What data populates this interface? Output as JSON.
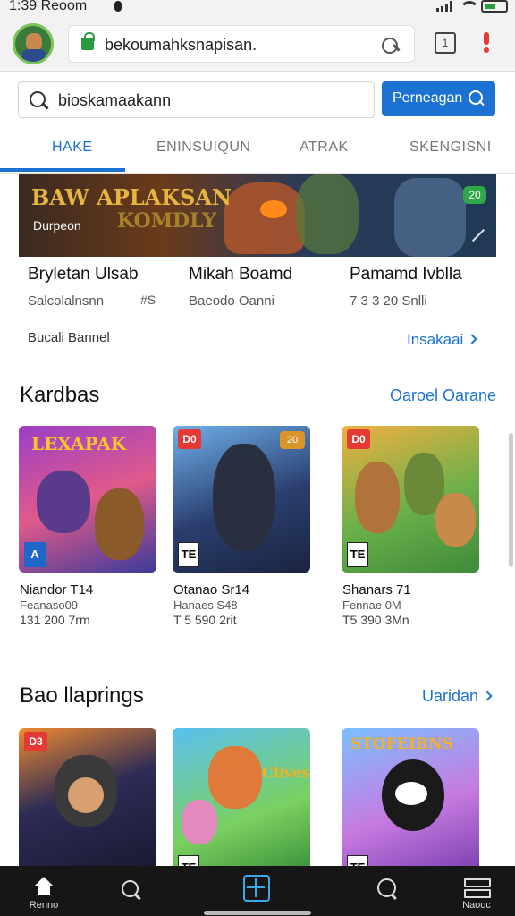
{
  "status_bar": {
    "time": "1:39 Reoom"
  },
  "browser": {
    "url": "bekoumahksnapisan.",
    "tabs_label": "1"
  },
  "search": {
    "value": "bioskamaakann",
    "button_label": "Perneagan"
  },
  "tabs": [
    {
      "label": "HAKE",
      "active": true
    },
    {
      "label": "ENINSUIQUN",
      "active": false
    },
    {
      "label": "ATRAK",
      "active": false
    },
    {
      "label": "SKENGISNI",
      "active": false
    }
  ],
  "banner": {
    "title": "BAW APLAKSAN",
    "title_line2": "KOMDLY",
    "subtitle": "Durpeon",
    "badge": "20"
  },
  "info": [
    {
      "title": "Bryletan Ulsab",
      "sub": "Salcolalnsnn"
    },
    {
      "title": "Mikah Boamd",
      "sub": "Baeodo Oanni"
    },
    {
      "title": "Pamamd Ivblla",
      "sub": "7 3 3 20 Snlli"
    }
  ],
  "info_extra": "#S",
  "links": {
    "left": "Bucali Bannel",
    "right": "Insakaai"
  },
  "section1": {
    "title": "Kardbas",
    "link": "Oaroel Oarane",
    "cards": [
      {
        "logo": "LEXAPAK",
        "tag": "",
        "tag_right": "",
        "rating": "A",
        "name": "Niandor T14",
        "dev": "Feanaso09",
        "meta": "131 200 7rm"
      },
      {
        "logo": "",
        "tag": "D0",
        "tag_right": "20",
        "rating": "TE",
        "name": "Otanao Sr14",
        "dev": "Hanaes S48",
        "meta": "T 5 590 2rit"
      },
      {
        "logo": "",
        "tag": "D0",
        "tag_right": "",
        "rating": "TE",
        "name": "Shanars 71",
        "dev": "Fennae 0M",
        "meta": "T5 390 3Mn"
      }
    ]
  },
  "section2": {
    "title": "Bao llaprings",
    "link": "Uaridan",
    "cards": [
      {
        "logo": "",
        "tag": "D3",
        "rating": ""
      },
      {
        "logo": "Clives",
        "tag": "",
        "rating": "TE"
      },
      {
        "logo": "STOFEIBNS",
        "tag": "",
        "rating": "TE"
      }
    ]
  },
  "bottom_nav": [
    {
      "label": "Renno",
      "icon": "home-icon"
    },
    {
      "label": "",
      "icon": "search-icon"
    },
    {
      "label": "",
      "icon": "tabs-icon"
    },
    {
      "label": "",
      "icon": "explore-icon"
    },
    {
      "label": "Naooc",
      "icon": "menu-icon"
    }
  ],
  "colors": {
    "accent": "#1b72d3",
    "nav_bg": "#161616",
    "alert": "#e53935"
  }
}
